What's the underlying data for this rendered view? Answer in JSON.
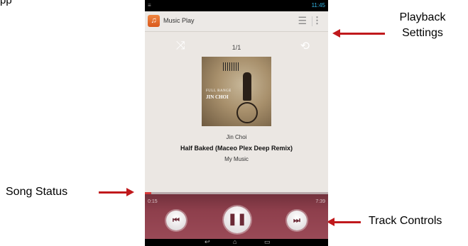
{
  "annotations": {
    "top_fragment": "pp",
    "playback_settings": "Playback Settings",
    "song_status": "Song Status",
    "track_controls": "Track Controls"
  },
  "statusbar": {
    "time": "11:45",
    "icons": [
      "wifi-icon",
      "signal-icon",
      "battery-icon"
    ]
  },
  "appbar": {
    "title": "Music Play",
    "app_icon": "music-note-icon",
    "menu_icons": [
      "list-icon",
      "overflow-menu-icon"
    ]
  },
  "player": {
    "track_position": "1/1",
    "artist": "Jin Choi",
    "song_title": "Half Baked (Maceo Plex Deep Remix)",
    "album": "My Music",
    "album_art_text": {
      "line1": "FULL RANGE",
      "line2": "JIN CHOI"
    }
  },
  "controls": {
    "elapsed": "0:15",
    "duration": "7:39",
    "progress": 0.033,
    "prev_icon": "previous-track-icon",
    "pause_icon": "pause-icon",
    "next_icon": "next-track-icon"
  },
  "colors": {
    "accent_red": "#c0191c",
    "controls_bg": "#8e3f4c",
    "progress_fill": "#d63a3a"
  }
}
